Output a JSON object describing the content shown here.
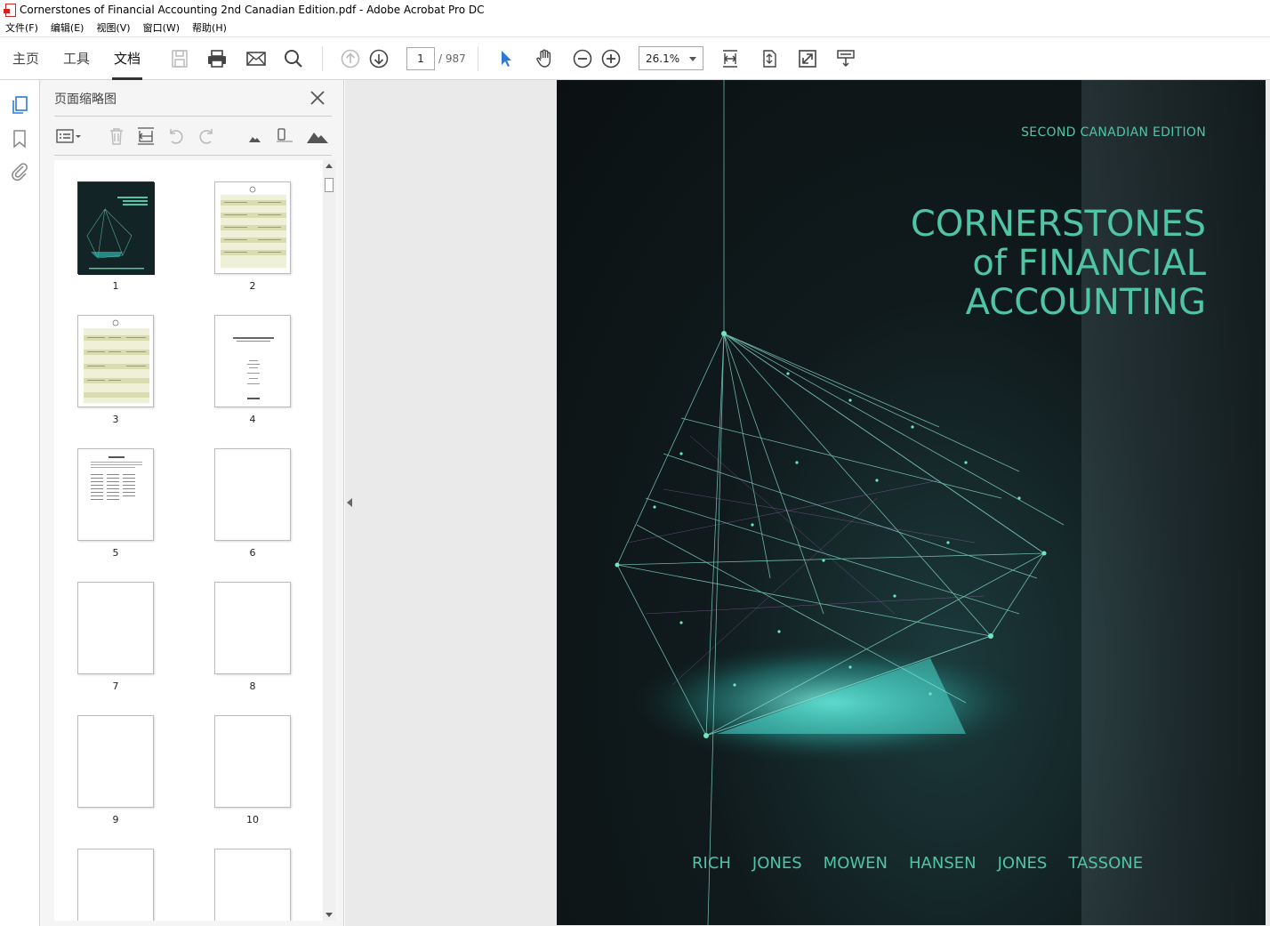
{
  "window": {
    "title": "Cornerstones of Financial Accounting 2nd Canadian Edition.pdf - Adobe Acrobat Pro DC"
  },
  "menu": [
    "文件(F)",
    "编辑(E)",
    "视图(V)",
    "窗口(W)",
    "帮助(H)"
  ],
  "tabs": {
    "home": "主页",
    "tools": "工具",
    "document": "文档"
  },
  "nav": {
    "current_page": "1",
    "total_pages": "/ 987",
    "zoom": "26.1%"
  },
  "panel": {
    "title": "页面缩略图",
    "thumbnails": [
      "1",
      "2",
      "3",
      "4",
      "5",
      "6",
      "7",
      "8",
      "9",
      "10"
    ]
  },
  "cover": {
    "edition": "SECOND CANADIAN EDITION",
    "title_line1": "CORNERSTONES",
    "title_line2": "of FINANCIAL",
    "title_line3": "ACCOUNTING",
    "authors": [
      "RICH",
      "JONES",
      "MOWEN",
      "HANSEN",
      "JONES",
      "TASSONE"
    ]
  },
  "colors": {
    "cover_accent": "#4fc5a5",
    "active_icon": "#2d7ad6"
  }
}
